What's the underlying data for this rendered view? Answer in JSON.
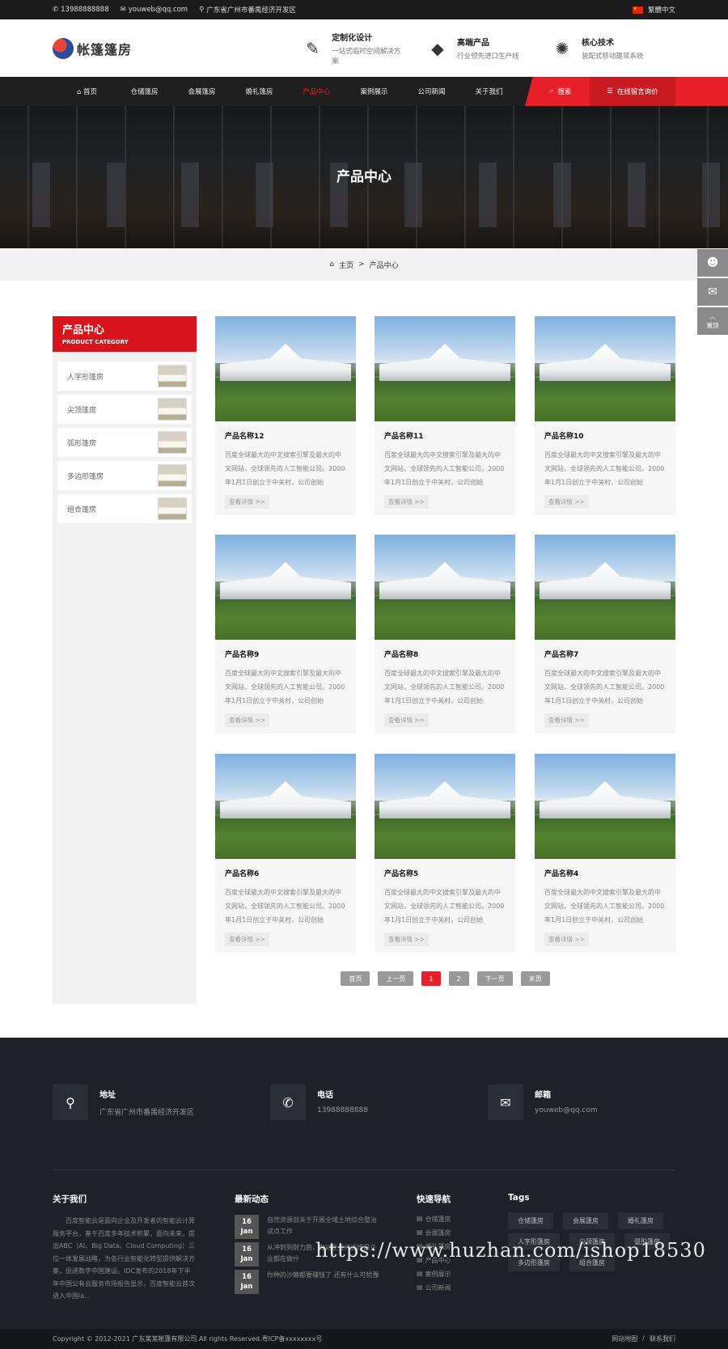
{
  "topbar": {
    "phone": "13988888888",
    "email": "youweb@qq.com",
    "address": "广东省广州市番禺经济开发区",
    "language": "繁體中文"
  },
  "header": {
    "logo_text": "帐篷篷房",
    "features": [
      {
        "icon": "design-tools-icon",
        "title": "定制化设计",
        "desc": "一站式临时空间解决方案"
      },
      {
        "icon": "diamond-icon",
        "title": "高端产品",
        "desc": "行业领先进口生产线"
      },
      {
        "icon": "lightbulb-icon",
        "title": "核心技术",
        "desc": "装配式移动建筑系统"
      }
    ]
  },
  "nav": {
    "items": [
      "首页",
      "仓储篷房",
      "会展篷房",
      "婚礼篷房",
      "产品中心",
      "案例展示",
      "公司新闻",
      "关于我们"
    ],
    "active_index": 4,
    "search_label": "搜索",
    "consult_label": "在线留言询价"
  },
  "banner": {
    "title": "产品中心"
  },
  "breadcrumb": {
    "home": "主页",
    "sep": ">",
    "current": "产品中心"
  },
  "float_bar": {
    "top_label": "置顶"
  },
  "sidebar": {
    "title": "产品中心",
    "subtitle": "PRODUCT CATEGORY",
    "items": [
      "人字形篷房",
      "尖顶篷房",
      "弧形篷房",
      "多边形篷房",
      "组合篷房"
    ]
  },
  "products": [
    {
      "name": "产品名称12",
      "desc": "百度全球最大的中文搜索引擎及最大的中文网站，全球领先的人工智能公司。2000年1月1日创立于中关村，公司创始",
      "more": "查看详情 >>"
    },
    {
      "name": "产品名称11",
      "desc": "百度全球最大的中文搜索引擎及最大的中文网站，全球领先的人工智能公司。2000年1月1日创立于中关村，公司创始",
      "more": "查看详情 >>"
    },
    {
      "name": "产品名称10",
      "desc": "百度全球最大的中文搜索引擎及最大的中文网站，全球领先的人工智能公司。2000年1月1日创立于中关村，公司创始",
      "more": "查看详情 >>"
    },
    {
      "name": "产品名称9",
      "desc": "百度全球最大的中文搜索引擎及最大的中文网站，全球领先的人工智能公司。2000年1月1日创立于中关村，公司创始",
      "more": "查看详情 >>"
    },
    {
      "name": "产品名称8",
      "desc": "百度全球最大的中文搜索引擎及最大的中文网站，全球领先的人工智能公司。2000年1月1日创立于中关村，公司创始",
      "more": "查看详情 >>"
    },
    {
      "name": "产品名称7",
      "desc": "百度全球最大的中文搜索引擎及最大的中文网站，全球领先的人工智能公司。2000年1月1日创立于中关村，公司创始",
      "more": "查看详情 >>"
    },
    {
      "name": "产品名称6",
      "desc": "百度全球最大的中文搜索引擎及最大的中文网站，全球领先的人工智能公司。2000年1月1日创立于中关村，公司创始",
      "more": "查看详情 >>"
    },
    {
      "name": "产品名称5",
      "desc": "百度全球最大的中文搜索引擎及最大的中文网站，全球领先的人工智能公司。2000年1月1日创立于中关村，公司创始",
      "more": "查看详情 >>"
    },
    {
      "name": "产品名称4",
      "desc": "百度全球最大的中文搜索引擎及最大的中文网站，全球领先的人工智能公司。2000年1月1日创立于中关村，公司创始",
      "more": "查看详情 >>"
    }
  ],
  "pagination": {
    "first": "首页",
    "prev": "上一页",
    "pages": [
      "1",
      "2"
    ],
    "current": "1",
    "next": "下一页",
    "last": "末页"
  },
  "footer": {
    "contacts": [
      {
        "icon": "location-pin-icon",
        "title": "地址",
        "value": "广东省广州市番禺经济开发区"
      },
      {
        "icon": "phone-icon",
        "title": "电话",
        "value": "13988888888"
      },
      {
        "icon": "envelope-icon",
        "title": "邮箱",
        "value": "youweb@qq.com"
      }
    ],
    "about_title": "关于我们",
    "about_text": "百度智能云是面向企业及开发者的智能云计算服务平台，基于百度多年技术积累，面向未来，提出ABC（AI、Big Data、Cloud Computing）三位一体发展战略，为各行业智能化转型提供解决方案，促进数字中国建设。IDC发布的2018年下半年中国公有云服务市场报告显示，百度智能云首次进入中国la...",
    "news_title": "最新动态",
    "news": [
      {
        "day": "16",
        "month": "Jan",
        "text": "自然资源部关于开展全域土地综合整治试点工作"
      },
      {
        "day": "16",
        "month": "Jan",
        "text": "从冲刺到耐力跑，你对企业IT运维是企业都在做什"
      },
      {
        "day": "16",
        "month": "Jan",
        "text": "你种的沙棘都要赚钱了 还有什么可犹豫"
      }
    ],
    "quick_title": "快速导航",
    "quick": [
      "仓储篷房",
      "会展篷房",
      "婚礼篷房",
      "产品中心",
      "案例展示",
      "公司新闻"
    ],
    "tags_title": "Tags",
    "tags": [
      "仓储篷房",
      "会展篷房",
      "婚礼篷房",
      "人字形篷房",
      "尖顶篷房",
      "弧形篷房",
      "多边形篷房",
      "组合篷房"
    ],
    "copyright": "Copyright © 2012-2021 广东某某帐篷有限公司 All rights Reserved.粤ICP备xxxxxxxx号",
    "links": [
      "网站地图",
      "/",
      "联系我们"
    ]
  },
  "watermark": "https://www.huzhan.com/ishop18530"
}
